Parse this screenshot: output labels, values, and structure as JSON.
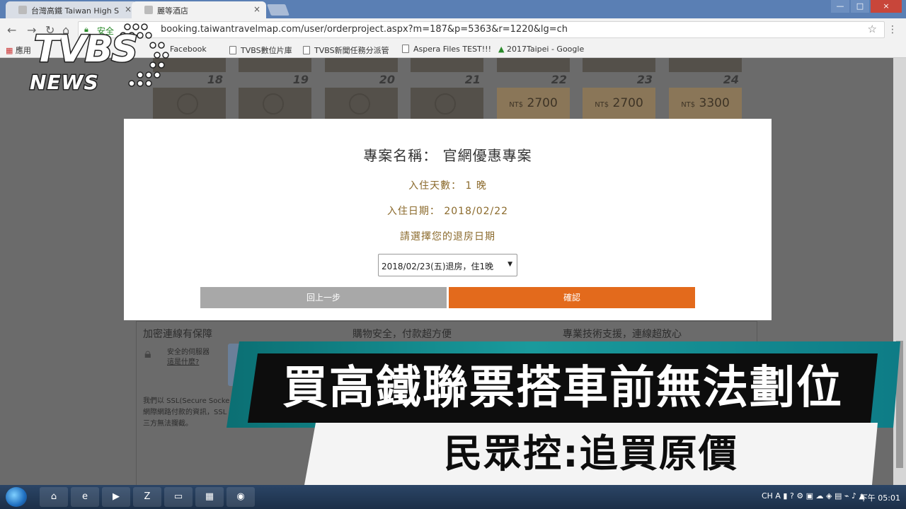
{
  "browser": {
    "tabs": [
      {
        "label": "台灣高鐵 Taiwan High S",
        "close": "×"
      },
      {
        "label": "麗等酒店",
        "close": "×"
      }
    ],
    "window_controls": [
      "—",
      "□",
      "×"
    ],
    "secure_label": "安全",
    "url": "booking.taiwantravelmap.com/user/orderproject.aspx?m=187&p=5363&r=1220&lg=ch",
    "bookmarks": [
      "應用",
      "Facebook",
      "TVBS數位片庫",
      "TVBS新聞任務分派管",
      "Aspera Files TEST!!!",
      "2017Taipei - Google"
    ]
  },
  "calendar": {
    "days": [
      "18",
      "19",
      "20",
      "21",
      "22",
      "23",
      "24"
    ],
    "prices": [
      {
        "currency": "NT$",
        "amount": "2700"
      },
      {
        "currency": "NT$",
        "amount": "2700"
      },
      {
        "currency": "NT$",
        "amount": "3300"
      }
    ]
  },
  "modal": {
    "title": "專案名稱： 官網優惠專案",
    "nights_line": "入住天數： 1 晚",
    "checkin_line": "入住日期： 2018/02/22",
    "prompt": "請選擇您的退房日期",
    "checkout_selected": "2018/02/23(五)退房，住1晚",
    "back_label": "回上一步",
    "confirm_label": "確認"
  },
  "footer": {
    "col1_title": "加密連線有保障",
    "col2_title": "購物安全，付款超方便",
    "col3_title": "專業技術支援，連線超放心",
    "server_note": "安全的伺服器",
    "what_is": "這是什麼?",
    "ssl_text_1": "我們以 SSL(Secure Socke",
    "ssl_text_2": "網際網路付款的資訊，SSL",
    "ssl_text_3": "三方無法攔截。"
  },
  "news": {
    "logo_top": "TVBS",
    "logo_bottom": "NEWS",
    "headline": "買高鐵聯票搭車前無法劃位",
    "subheadline": "民眾控:追買原價"
  },
  "taskbar": {
    "tray_lang": "CH",
    "clock": "下午 05:01"
  },
  "colors": {
    "confirm": "#e36a1c",
    "back": "#a8a8a8",
    "headline_teal": "#0e7c86",
    "modal_text": "#8b6a2c"
  }
}
